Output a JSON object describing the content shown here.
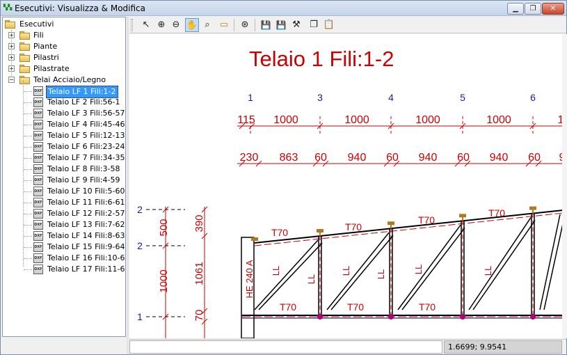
{
  "window": {
    "title": "Esecutivi: Visualizza & Modifica",
    "icon": "app-icon"
  },
  "tree": {
    "root": "Esecutivi",
    "folders": [
      {
        "label": "Fili",
        "expander": "+"
      },
      {
        "label": "Piante",
        "expander": "+"
      },
      {
        "label": "Pilastri",
        "expander": "+"
      },
      {
        "label": "Pilastrate",
        "expander": "+"
      },
      {
        "label": "Telai Acciaio/Legno",
        "expander": "−"
      }
    ],
    "items": [
      "Telaio LF 1 Fili:1-2",
      "Telaio LF 2 Fili:56-1",
      "Telaio LF 3 Fili:56-57",
      "Telaio LF 4 Fili:45-46",
      "Telaio LF 5 Fili:12-13",
      "Telaio LF 6 Fili:23-24",
      "Telaio LF 7 Fili:34-35",
      "Telaio LF 8 Fili:3-58",
      "Telaio LF 9 Fili:4-59",
      "Telaio LF 10 Fili:5-60",
      "Telaio LF 11 Fili:6-61",
      "Telaio LF 12 Fili:2-57",
      "Telaio LF 13 Fili:7-62",
      "Telaio LF 14 Fili:8-63",
      "Telaio LF 15 Fili:9-64",
      "Telaio LF 16 Fili:10-65",
      "Telaio LF 17 Fili:11-66"
    ],
    "selected_index": 0,
    "item_icon_text": "DXF"
  },
  "toolbar": [
    {
      "name": "pointer-icon",
      "glyph": "↖"
    },
    {
      "name": "zoom-in-icon",
      "glyph": "⊕"
    },
    {
      "name": "zoom-out-icon",
      "glyph": "⊖"
    },
    {
      "name": "pan-hand-icon",
      "glyph": "✋",
      "active": true
    },
    {
      "name": "zoom-window-icon",
      "glyph": "⌕"
    },
    {
      "name": "measure-ruler-icon",
      "glyph": "▭"
    },
    {
      "name": "zoom-extents-icon",
      "glyph": "⊛"
    },
    {
      "name": "save-icon",
      "glyph": "💾"
    },
    {
      "name": "save-as-icon",
      "glyph": "💾"
    },
    {
      "name": "tools-icon",
      "glyph": "⚒"
    },
    {
      "name": "copy-icon",
      "glyph": "❐"
    },
    {
      "name": "paste-icon",
      "glyph": "📋"
    }
  ],
  "drawing": {
    "title": "Telaio 1 Fili:1-2",
    "column_labels": [
      "1",
      "3",
      "4",
      "5",
      "6"
    ],
    "dim_row1": [
      "115",
      "1000",
      "1000",
      "1000",
      "1000",
      "1"
    ],
    "dim_row2": [
      "230",
      "863",
      "60",
      "940",
      "60",
      "940",
      "60",
      "940",
      "60",
      "9"
    ],
    "left_level_labels": [
      "2",
      "2",
      "1"
    ],
    "left_dims_a": [
      "500",
      "1000"
    ],
    "left_dims_b": [
      "390",
      "1061",
      "70"
    ],
    "member_top": [
      "T70",
      "T70",
      "T70",
      "T70"
    ],
    "member_bottom": [
      "T70",
      "T70",
      "T70"
    ],
    "diagonal_labels": [
      "LL",
      "LL",
      "LL",
      "LL",
      "LL",
      "LL"
    ],
    "column_section": "HE 240 A",
    "colors": {
      "red": "#cc0000",
      "blue": "#1a1aa8",
      "black": "#000000",
      "magenta": "#b0007a",
      "bolt": "#b07820"
    }
  },
  "status": {
    "left": "",
    "coords": "1.6699; 9.9541"
  }
}
